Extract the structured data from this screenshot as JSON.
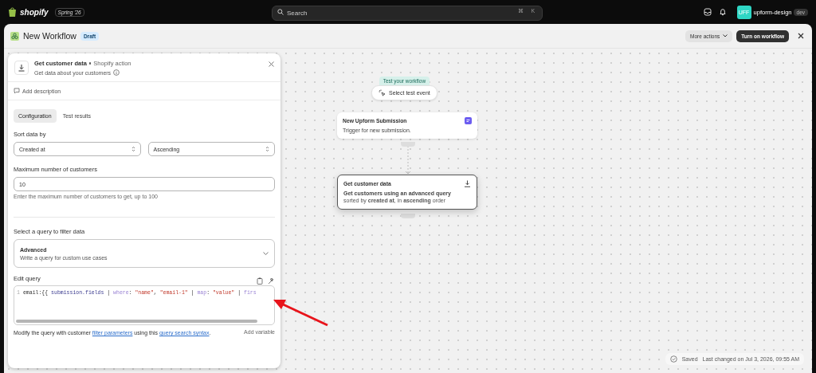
{
  "topbar": {
    "brand": "shopify",
    "edition": "Spring '26",
    "search": {
      "placeholder": "Search",
      "keys": [
        "⌘",
        "K"
      ]
    },
    "avatar": "UFF",
    "store": "upform-design",
    "store_badge": "dev"
  },
  "header": {
    "title": "New Workflow",
    "badge": "Draft",
    "more_actions": "More actions",
    "primary": "Turn on workflow"
  },
  "panel": {
    "title": "Get customer data",
    "subtitle": "Shopify action",
    "description": "Get data about your customers",
    "add_description": "Add description",
    "tabs": [
      {
        "label": "Configuration",
        "selected": true
      },
      {
        "label": "Test results",
        "selected": false
      }
    ],
    "sort_label": "Sort data by",
    "sort_field": "Created at",
    "sort_order": "Ascending",
    "max_label": "Maximum number of customers",
    "max_value": "10",
    "max_help": "Enter the maximum number of customers to get, up to 100",
    "query_label": "Select a query to filter data",
    "query_title": "Advanced",
    "query_subtitle": "Write a query for custom use cases",
    "edit_label": "Edit query",
    "line_number": "1",
    "code": [
      {
        "kind": "plain",
        "text": "email:{{ "
      },
      {
        "kind": "var",
        "text": "submission.fields"
      },
      {
        "kind": "plain",
        "text": " | "
      },
      {
        "kind": "filter",
        "text": "where"
      },
      {
        "kind": "plain",
        "text": ": "
      },
      {
        "kind": "string",
        "text": "\"name\""
      },
      {
        "kind": "plain",
        "text": ", "
      },
      {
        "kind": "string",
        "text": "\"email-1\""
      },
      {
        "kind": "plain",
        "text": " | "
      },
      {
        "kind": "filter",
        "text": "map"
      },
      {
        "kind": "plain",
        "text": ": "
      },
      {
        "kind": "string",
        "text": "\"value\""
      },
      {
        "kind": "plain",
        "text": " | "
      },
      {
        "kind": "filter",
        "text": "firs"
      }
    ],
    "help": [
      {
        "kind": "text",
        "text": "Modify the query with customer "
      },
      {
        "kind": "link",
        "text": "filter parameters"
      },
      {
        "kind": "text",
        "text": " using this "
      },
      {
        "kind": "link",
        "text": "query search syntax"
      },
      {
        "kind": "text",
        "text": "."
      }
    ],
    "add_variable": "Add variable"
  },
  "canvas": {
    "test_label": "Test your workflow",
    "test_button": "Select test event",
    "nodes": [
      {
        "kind": "trigger",
        "title": "New Upform Submission",
        "body": "Trigger for new submission.",
        "selected": false
      },
      {
        "kind": "action",
        "title": "Get customer data",
        "body": "**Get customers using an advanced query**",
        "detail": "sorted by **created at**, in **ascending** order",
        "selected": true
      }
    ]
  },
  "status": {
    "saved": "Saved",
    "changed": "Last changed on Jul 3, 2026, 09:55 AM"
  }
}
